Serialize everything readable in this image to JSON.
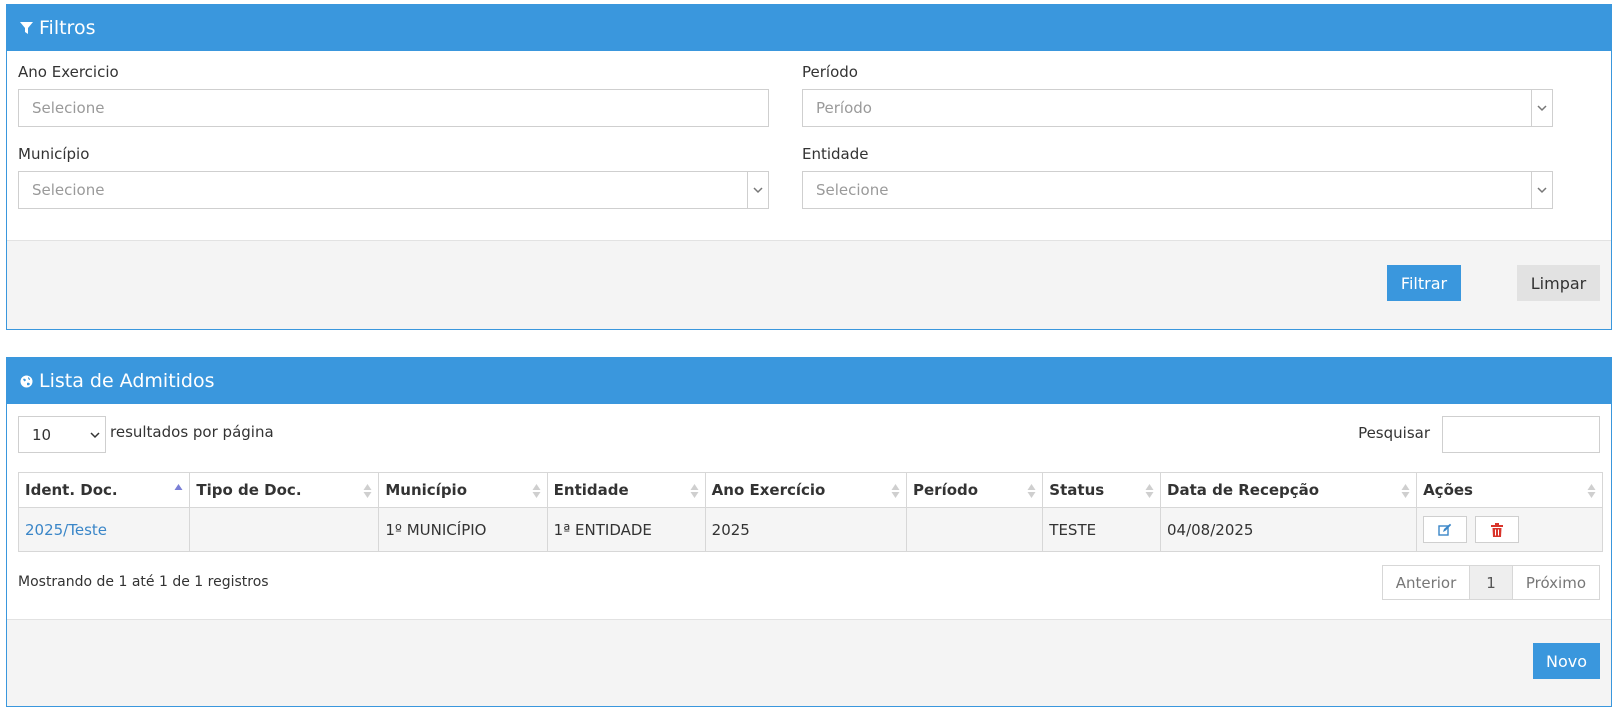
{
  "filters": {
    "title": "Filtros",
    "icon": "filter-icon",
    "ano_exercicio": {
      "label": "Ano Exercicio",
      "placeholder": "Selecione"
    },
    "periodo": {
      "label": "Período",
      "placeholder": "Período"
    },
    "municipio": {
      "label": "Município",
      "placeholder": "Selecione"
    },
    "entidade": {
      "label": "Entidade",
      "placeholder": "Selecione"
    },
    "filter_button": "Filtrar",
    "clear_button": "Limpar"
  },
  "list": {
    "title": "Lista de Admitidos",
    "icon": "globe-icon",
    "page_size": "10",
    "page_size_label": "resultados por página",
    "search_label": "Pesquisar",
    "search_value": "",
    "columns": [
      "Ident. Doc.",
      "Tipo de Doc.",
      "Município",
      "Entidade",
      "Ano Exercício",
      "Período",
      "Status",
      "Data de Recepção",
      "Ações"
    ],
    "rows": [
      {
        "ident": "2025/Teste",
        "tipo": "",
        "municipio": "1º MUNICÍPIO",
        "entidade": "1ª ENTIDADE",
        "ano": "2025",
        "periodo": "",
        "status": "TESTE",
        "data": "04/08/2025"
      }
    ],
    "info": "Mostrando de 1 até 1 de 1 registros",
    "pager": {
      "prev": "Anterior",
      "current": "1",
      "next": "Próximo"
    },
    "new_button": "Novo"
  },
  "colors": {
    "primary": "#3a97dd",
    "delete": "#d9342b",
    "link": "#3a86c8"
  }
}
